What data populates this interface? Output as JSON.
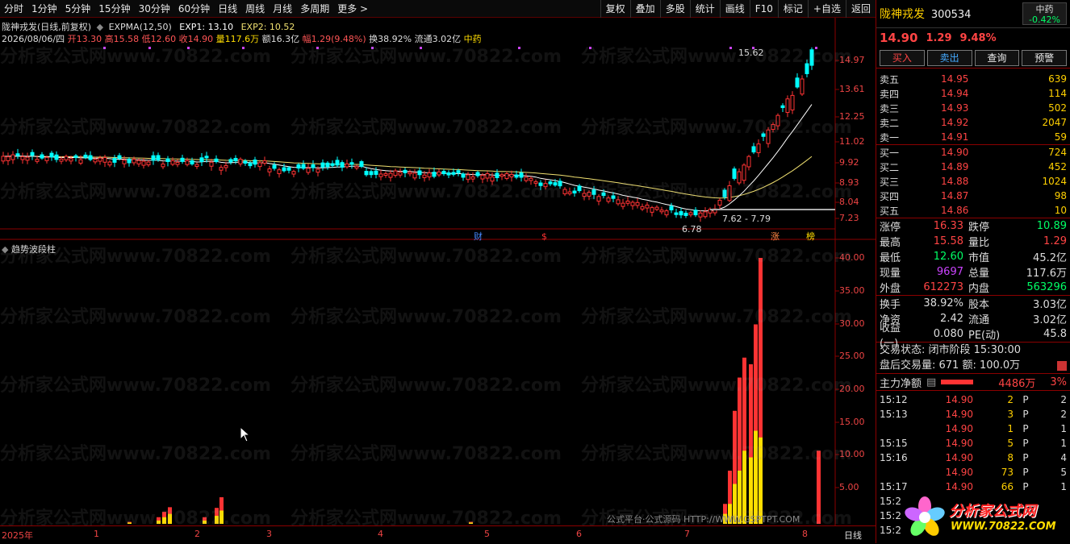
{
  "toolbar": {
    "periods": [
      "分时",
      "1分钟",
      "5分钟",
      "15分钟",
      "30分钟",
      "60分钟",
      "日线",
      "周线",
      "月线",
      "多周期",
      "更多 >"
    ],
    "actions": [
      "复权",
      "叠加",
      "多股",
      "统计",
      "画线",
      "F10",
      "标记",
      "+自选",
      "返回"
    ]
  },
  "main_chart": {
    "title": "陇神戎发(日线,前复权)",
    "indicator": "EXPMA(12,50)",
    "exp1": "EXP1: 13.10",
    "exp2": "EXP2: 10.52",
    "date": "2026/08/06/四",
    "open": "开13.30",
    "high": "高15.58",
    "low": "低12.60",
    "close": "收14.90",
    "volume": "量117.6万",
    "amount": "额16.3亿",
    "change": "幅1.29(9.48%)",
    "turnover": "换38.92%",
    "float_cap": "流通3.02亿",
    "tag": "中药",
    "yaxis": [
      "14.97",
      "13.61",
      "12.25",
      "11.02",
      "9.92",
      "8.93",
      "8.04",
      "7.23"
    ],
    "hi_label": "15.62",
    "lo_label": "6.78",
    "range_label": "7.62 - 7.79",
    "markers": [
      "财",
      "$",
      "涨",
      "榜"
    ]
  },
  "sub_chart": {
    "title": "趋势波段柱",
    "yaxis": [
      "40.00",
      "35.00",
      "30.00",
      "25.00",
      "20.00",
      "15.00",
      "10.00",
      "5.00"
    ]
  },
  "xaxis": {
    "labels": [
      "2025年",
      "1",
      "2",
      "3",
      "4",
      "5",
      "6",
      "7",
      "8"
    ],
    "period": "日线"
  },
  "quote": {
    "name": "陇神戎发",
    "code": "300534",
    "industry": "中药",
    "industry_change": "-0.42%",
    "price": "14.90",
    "change": "1.29",
    "change_pct": "9.48%",
    "buttons": [
      "买入",
      "卖出",
      "查询",
      "预警"
    ],
    "asks": [
      {
        "label": "卖五",
        "price": "14.95",
        "vol": "639"
      },
      {
        "label": "卖四",
        "price": "14.94",
        "vol": "114"
      },
      {
        "label": "卖三",
        "price": "14.93",
        "vol": "502"
      },
      {
        "label": "卖二",
        "price": "14.92",
        "vol": "2047"
      },
      {
        "label": "卖一",
        "price": "14.91",
        "vol": "59"
      }
    ],
    "bids": [
      {
        "label": "买一",
        "price": "14.90",
        "vol": "724"
      },
      {
        "label": "买二",
        "price": "14.89",
        "vol": "452"
      },
      {
        "label": "买三",
        "price": "14.88",
        "vol": "1024"
      },
      {
        "label": "买四",
        "price": "14.87",
        "vol": "98"
      },
      {
        "label": "买五",
        "price": "14.86",
        "vol": "10"
      }
    ],
    "stats": [
      {
        "l": "涨停",
        "v": "16.33",
        "l2": "跌停",
        "v2": "10.89"
      },
      {
        "l": "最高",
        "v": "15.58",
        "l2": "量比",
        "v2": "1.29"
      },
      {
        "l": "最低",
        "v": "12.60",
        "l2": "市值",
        "v2": "45.2亿"
      },
      {
        "l": "现量",
        "v": "9697",
        "l2": "总量",
        "v2": "117.6万"
      },
      {
        "l": "外盘",
        "v": "612273",
        "l2": "内盘",
        "v2": "563296"
      }
    ],
    "stats2": [
      {
        "l": "换手",
        "v": "38.92%",
        "l2": "股本",
        "v2": "3.03亿"
      },
      {
        "l": "净资",
        "v": "2.42",
        "l2": "流通",
        "v2": "3.02亿"
      },
      {
        "l": "收益(一)",
        "v": "0.080",
        "l2": "PE(动)",
        "v2": "45.8"
      }
    ],
    "trade_state": "交易状态: 闭市阶段 15:30:00",
    "after_hours": "盘后交易量: 671  额: 100.0万",
    "main_flow_label": "主力净额",
    "main_flow_value": "4486万",
    "main_flow_pct": "3%",
    "ticks": [
      {
        "t": "15:12",
        "p": "14.90",
        "n": "2",
        "f": "P",
        "c": "2"
      },
      {
        "t": "15:13",
        "p": "14.90",
        "n": "3",
        "f": "P",
        "c": "2"
      },
      {
        "t": "",
        "p": "14.90",
        "n": "1",
        "f": "P",
        "c": "1"
      },
      {
        "t": "15:15",
        "p": "14.90",
        "n": "5",
        "f": "P",
        "c": "1"
      },
      {
        "t": "15:16",
        "p": "14.90",
        "n": "8",
        "f": "P",
        "c": "4"
      },
      {
        "t": "",
        "p": "14.90",
        "n": "73",
        "f": "P",
        "c": "5"
      },
      {
        "t": "15:17",
        "p": "14.90",
        "n": "66",
        "f": "P",
        "c": "1"
      },
      {
        "t": "15:2",
        "p": "",
        "n": "",
        "f": "",
        "c": ""
      },
      {
        "t": "15:2",
        "p": "",
        "n": "",
        "f": "",
        "c": ""
      },
      {
        "t": "15:2",
        "p": "",
        "n": "",
        "f": "",
        "c": ""
      }
    ]
  },
  "watermark": "分析家公式网www.70822.com",
  "footnote": "公式平台·公式源码 HTTP://WWW.GSPTPT.COM",
  "logo": {
    "line1": "分析家公式网",
    "line2": "WWW.70822.COM"
  },
  "colors": {
    "up": "#ff3333",
    "down": "#00ffff",
    "yellow": "#ffdd00",
    "exp1": "#ffffff",
    "exp2": "#f0e070",
    "grid": "#8b0000"
  }
}
